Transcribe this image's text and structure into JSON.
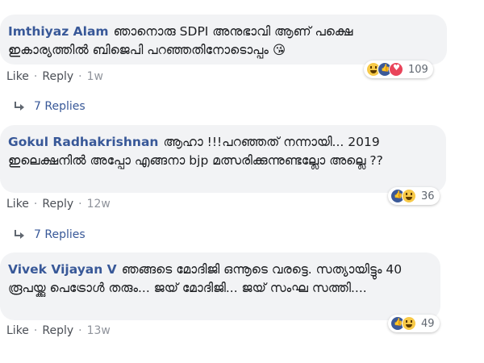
{
  "comments": [
    {
      "author": "Imthiyaz Alam",
      "text": "ഞാനൊരു SDPI അനുഭാവി ആണ് പക്ഷെ ഇകാര്യത്തിൽ ബിജെപി പറഞ്ഞതിനോടൊപ്പം 😘",
      "reactions": [
        "haha",
        "like",
        "love"
      ],
      "reaction_count": "109",
      "like_label": "Like",
      "reply_label": "Reply",
      "time": "1w",
      "replies_label": "7 Replies"
    },
    {
      "author": "Gokul Radhakrishnan",
      "text": "ആഹാ !!!പറഞ്ഞത് നന്നായി... 2019 ഇലെക്ഷനിൽ അപ്പോ എങ്ങനാ bjp മത്സരിക്കുന്നുണ്ടല്ലോ അല്ലെ ??",
      "reactions": [
        "like",
        "haha"
      ],
      "reaction_count": "36",
      "like_label": "Like",
      "reply_label": "Reply",
      "time": "12w",
      "replies_label": "7 Replies"
    },
    {
      "author": "Vivek Vijayan V",
      "text": "ഞങ്ങടെ മോദിജി ഒന്നൂടെ വരട്ടെ. സത്യായിട്ടും 40 രൂപയ്ക്കു പെട്രോൾ തരും... ജയ് മോദിജി... ജയ് സംഘ സത്തി....",
      "reactions": [
        "like",
        "haha"
      ],
      "reaction_count": "49",
      "like_label": "Like",
      "reply_label": "Reply",
      "time": "13w"
    }
  ]
}
